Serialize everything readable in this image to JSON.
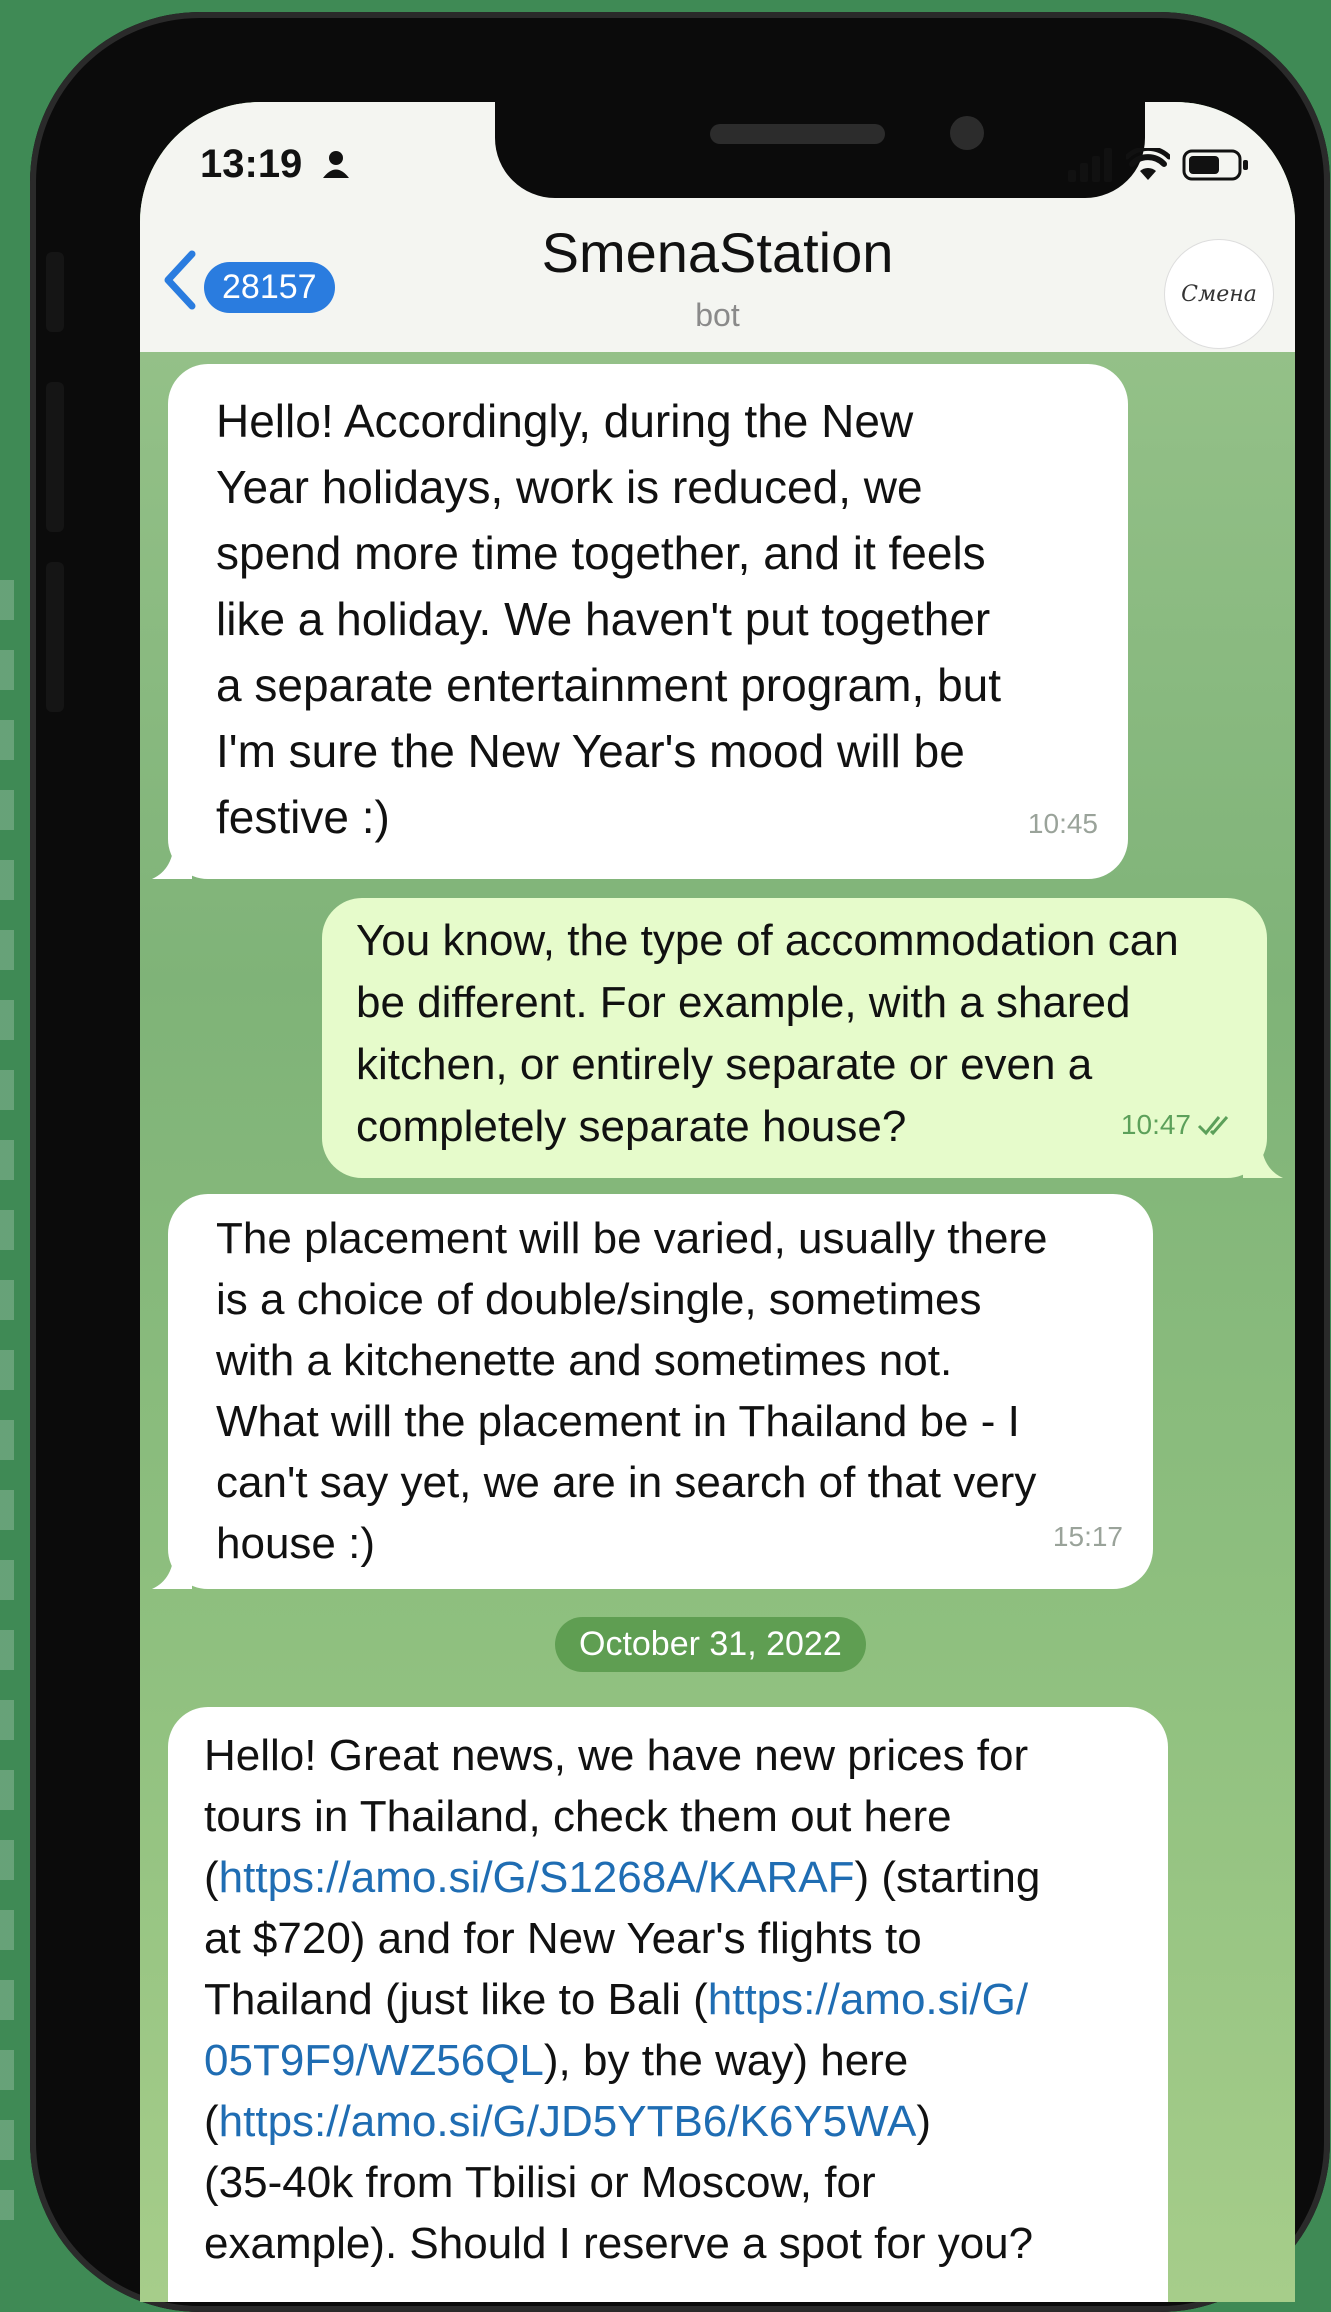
{
  "status_bar": {
    "time": "13:19"
  },
  "header": {
    "unread_count": "28157",
    "title": "SmenaStation",
    "subtitle": "bot",
    "avatar_text": "Смена"
  },
  "messages": [
    {
      "direction": "in",
      "text": "Hello! Accordingly, during the New\nYear holidays, work is reduced, we\nspend more time together, and it feels\nlike a holiday. We haven't put together\na separate entertainment program, but\nI'm sure the New Year's mood will be\nfestive :)",
      "time": "10:45"
    },
    {
      "direction": "out",
      "text": "You know, the type of accommodation can\nbe different. For example, with a shared\nkitchen, or entirely separate or even a\ncompletely separate house?",
      "time": "10:47"
    },
    {
      "direction": "in",
      "text": "The placement will be varied, usually there\nis a choice of double/single, sometimes\nwith a kitchenette and sometimes not.\nWhat will the placement in Thailand be - I\ncan't say yet, we are in search of that very\nhouse :)",
      "time": "15:17"
    }
  ],
  "date_separator": "October 31, 2022",
  "last_message": {
    "text_1": "Hello! Great news, we have new prices for\ntours in Thailand, check them out here\n(",
    "link_1": "https://amo.si/G/S1268A/KARAF",
    "text_2": ") (starting\nat $720) and for New Year's flights to\nThailand (just like to Bali (",
    "link_2": "https://amo.si/G/\n05T9F9/WZ56QL",
    "text_3": "), by the way) here\n(",
    "link_3": "https://amo.si/G/JD5YTB6/K6Y5WA",
    "text_4": ")\n(35-40k from Tbilisi or Moscow, for\nexample). Should I reserve a spot for you?"
  },
  "colors": {
    "background": "#3f8a55",
    "incoming_bubble": "#ffffff",
    "outgoing_bubble": "#e6fbcb",
    "link": "#1f6db3",
    "badge": "#2a7cdf"
  }
}
